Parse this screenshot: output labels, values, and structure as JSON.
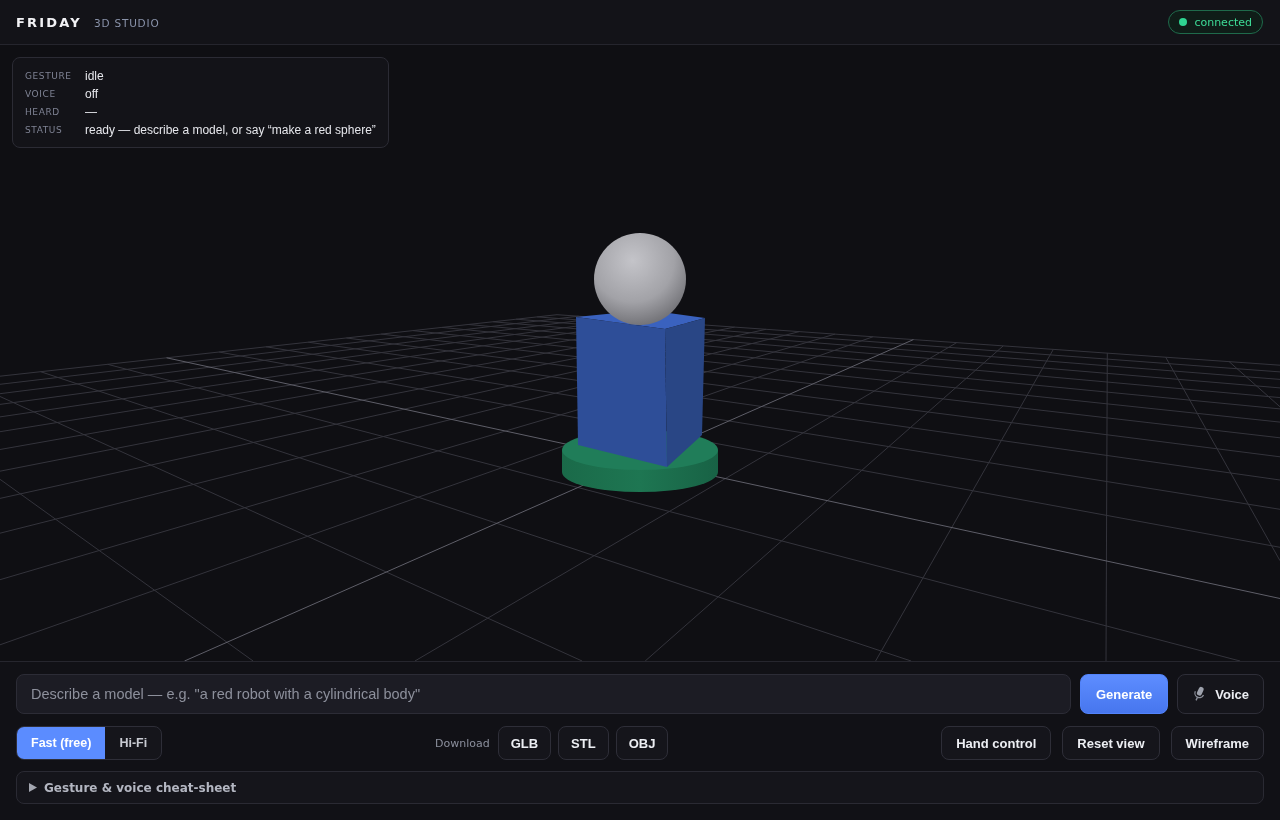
{
  "header": {
    "brand": "FRIDAY",
    "subtitle": "3D STUDIO",
    "connection": {
      "label": "connected",
      "on": true
    }
  },
  "hud": [
    {
      "label": "GESTURE",
      "value": "idle"
    },
    {
      "label": "VOICE",
      "value": "off"
    },
    {
      "label": "HEARD",
      "value": "—"
    },
    {
      "label": "STATUS",
      "value": "ready — describe a model, or say “make a red sphere”"
    }
  ],
  "prompt": {
    "placeholder": "Describe a model — e.g. \"a red robot with a cylindrical body\"",
    "actions": [
      {
        "label": "Generate",
        "kind": "primary"
      },
      {
        "label": "Voice",
        "kind": "mic"
      }
    ]
  },
  "modes": [
    {
      "label": "Fast (free)",
      "selected": true
    },
    {
      "label": "Hi-Fi",
      "selected": false
    }
  ],
  "download": {
    "label": "Download",
    "formats": [
      "GLB",
      "STL",
      "OBJ"
    ]
  },
  "view_buttons": [
    "Hand control",
    "Reset view",
    "Wireframe"
  ],
  "cheat_sheet": {
    "label": "Gesture & voice cheat-sheet",
    "expanded": false
  }
}
